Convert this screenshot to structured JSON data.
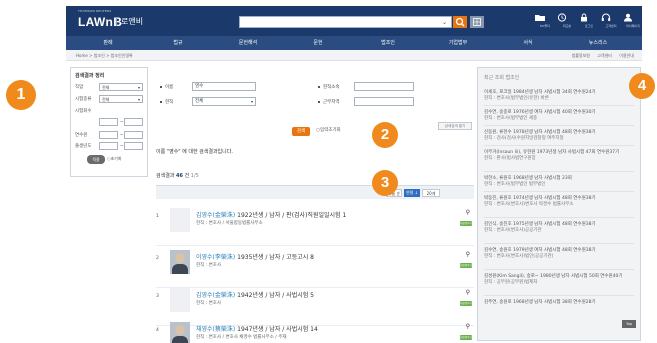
{
  "header": {
    "logo_small": "THOMSON REUTERS",
    "logo_main": "LAWnB",
    "logo_sub": "로앤비",
    "search_value": "",
    "icons": [
      {
        "name": "folder-icon",
        "label": "MY폴더"
      },
      {
        "name": "clock-icon",
        "label": "최근본"
      },
      {
        "name": "lock-icon",
        "label": "로그인"
      },
      {
        "name": "headset-icon",
        "label": "고객센터"
      },
      {
        "name": "user-icon",
        "label": "마이페이지"
      }
    ]
  },
  "nav": {
    "items": [
      "판례",
      "법규",
      "문헌해석",
      "문헌",
      "법조인",
      "기업법무",
      "서식",
      "뉴스리스"
    ]
  },
  "subbar": {
    "breadcrumb": "Home > 법조인 > 법조인인명록",
    "links": [
      "법률정보원",
      "고객센터",
      "이용안내"
    ]
  },
  "left_panel": {
    "title": "검색결과 정리",
    "labels": [
      "직업",
      "시험종류",
      "시험회수",
      "연수원",
      "출생년도"
    ],
    "job_select": "전체",
    "exam_select": "전체",
    "search_btn": "적용",
    "reset_btn": "초기화"
  },
  "form": {
    "name_label": "이름",
    "name_value": "영수",
    "job_label": "현직",
    "job_select": "전체",
    "office_label": "현직소속",
    "region_label": "근무지역",
    "search_btn": "검색",
    "detail_label": "입력초기화",
    "advanced_btn": "상세검색 열기"
  },
  "results": {
    "message": "이름 \"영수\" 에 대한 검색결과입니다.",
    "count_prefix": "검색결과",
    "count": "46",
    "count_suffix": "건",
    "page": "1/5",
    "sort_name": "이름 순",
    "sort_year": "연령 ↓",
    "per_page": "20개",
    "rows": [
      {
        "num": "1",
        "name": "김영수(金榮洙)",
        "info": " 1922년생 / 남자 / 판(검사)직원일일시험 1",
        "desc": "현직 : 변호사 / 서울합동법률사무소",
        "badge": "대한법학사",
        "photo": false
      },
      {
        "num": "2",
        "name": "이영수(李榮洙)",
        "info": " 1935년생 / 남자 / 고등고시 8",
        "desc": "현직 : 변호사",
        "badge": "대한법학사",
        "photo": true
      },
      {
        "num": "3",
        "name": "김영수(金榮洙)",
        "info": " 1942년생 / 남자 / 사법시험 5",
        "desc": "현직 : 변호사",
        "badge": "대한법학사",
        "photo": false
      },
      {
        "num": "4",
        "name": "채영수(蔡榮洙)",
        "info": " 1947년생 / 남자 / 사법시험 14",
        "desc": "현직 : 변호사 / 변호사 채영수 법률사무소 / 주재",
        "badge": "대한법학사",
        "photo": true
      }
    ]
  },
  "right_panel": {
    "title": "최근 조회 법조인",
    "items": [
      {
        "line1": "이세호, 로크일 1984년생 남자 사법시험 34회 연수원24기",
        "line2": "현직 : 변호사(법무법인(유한) 바른"
      },
      {
        "line1": "김수연, 송중로 1976년생 여자 사법시험 40회 연수원30기",
        "line2": "현직 : 변호사(법무법인 세종"
      },
      {
        "line1": "신동원, 류현수 1978년생 남자 사법시험 48회 연수원38기",
        "line2": "현직 : 검사(검사(수원지방검찰청 여주지청"
      },
      {
        "line1": "이무거(Insaun lii), 유현원 1973년생 남자 사법시험 47회 연수원37기",
        "line2": "현직 : 판사(법사법연구원장"
      },
      {
        "line1": "박한소, 류원호 1968년생 남자 사법시험 23회",
        "line2": "현직 : 변호사(법무법인 법무법인"
      },
      {
        "line1": "박동진, 류원호 1974년생 남자 사법시험 48회 연수원38기",
        "line2": "현직 : 변호사(변호사)변호사 박경수 법률사무소"
      },
      {
        "line1": "김인식, 송진호 1975년생 남자 사법시험 48회 연수원38기",
        "line2": "현직 : 변호사(변호사)공공기관"
      },
      {
        "line1": "김수연, 송원호 1979년생 여자 사법시험 48회 연수원38기",
        "line2": "현직 : 변호사(변호사)법인(공공기관)"
      },
      {
        "line1": "김성원(Kim Sangil), 송로~ 1980년생 남자 사법시험 50회 연수원40기",
        "line2": "현직 : 공무원(공무원)법제처"
      },
      {
        "line1": "김주연, 송원로 1968년생 남자 사법시험 38회 연수원28기",
        "line2": ""
      }
    ],
    "top_btn": "Top"
  },
  "callouts": [
    "1",
    "2",
    "3",
    "4"
  ],
  "colors": {
    "header": "#1b3a6b",
    "nav": "#2a4c80",
    "accent": "#e8750f",
    "callout": "#f08a1c",
    "link": "#2a7fb8",
    "badge": "#6bb04f"
  }
}
